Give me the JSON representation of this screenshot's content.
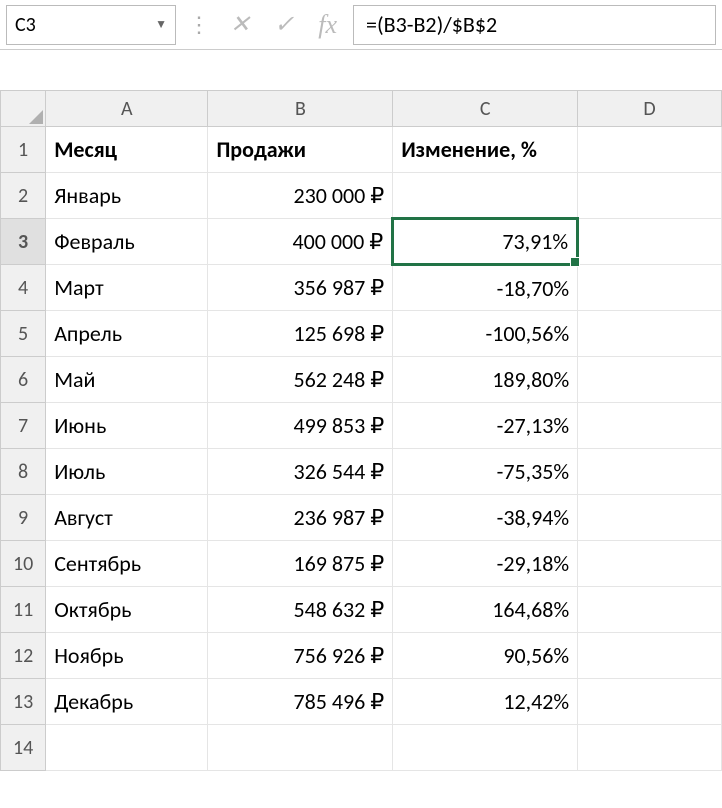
{
  "nameBox": "C3",
  "formula": "=(B3-B2)/$B$2",
  "columns": [
    "A",
    "B",
    "C",
    "D"
  ],
  "headers": {
    "month": "Месяц",
    "sales": "Продажи",
    "change": "Изменение, %"
  },
  "selectedCell": {
    "row": 3,
    "col": "C"
  },
  "rows": [
    {
      "n": 1,
      "month": "",
      "sales": "",
      "change": ""
    },
    {
      "n": 2,
      "month": "Январь",
      "sales": "230 000 ₽",
      "change": ""
    },
    {
      "n": 3,
      "month": "Февраль",
      "sales": "400 000 ₽",
      "change": "73,91%"
    },
    {
      "n": 4,
      "month": "Март",
      "sales": "356 987 ₽",
      "change": "-18,70%"
    },
    {
      "n": 5,
      "month": "Апрель",
      "sales": "125 698 ₽",
      "change": "-100,56%"
    },
    {
      "n": 6,
      "month": "Май",
      "sales": "562 248 ₽",
      "change": "189,80%"
    },
    {
      "n": 7,
      "month": "Июнь",
      "sales": "499 853 ₽",
      "change": "-27,13%"
    },
    {
      "n": 8,
      "month": "Июль",
      "sales": "326 544 ₽",
      "change": "-75,35%"
    },
    {
      "n": 9,
      "month": "Август",
      "sales": "236 987 ₽",
      "change": "-38,94%"
    },
    {
      "n": 10,
      "month": "Сентябрь",
      "sales": "169 875 ₽",
      "change": "-29,18%"
    },
    {
      "n": 11,
      "month": "Октябрь",
      "sales": "548 632 ₽",
      "change": "164,68%"
    },
    {
      "n": 12,
      "month": "Ноябрь",
      "sales": "756 926 ₽",
      "change": "90,56%"
    },
    {
      "n": 13,
      "month": "Декабрь",
      "sales": "785 496 ₽",
      "change": "12,42%"
    },
    {
      "n": 14,
      "month": "",
      "sales": "",
      "change": ""
    }
  ]
}
